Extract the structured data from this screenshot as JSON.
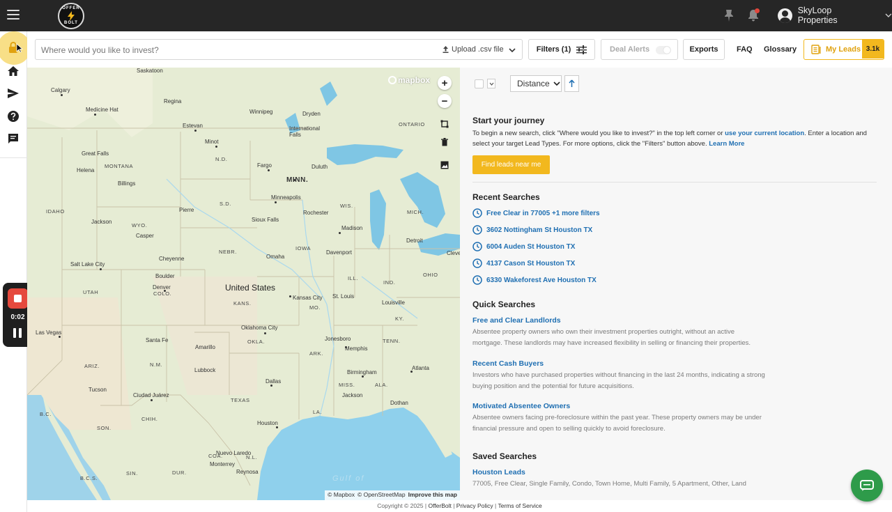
{
  "header": {
    "logo_text_top": "OFFER",
    "logo_text_bottom": "BOLT",
    "account_name": "SkyLoop Properties"
  },
  "recorder": {
    "time": "0:02"
  },
  "search": {
    "placeholder": "Where would you like to invest?",
    "upload_label": "Upload .csv file"
  },
  "toolbar": {
    "filters_label": "Filters (1)",
    "deal_alerts_label": "Deal Alerts",
    "exports_label": "Exports",
    "faq_label": "FAQ",
    "glossary_label": "Glossary",
    "my_leads_label": "My Leads",
    "my_leads_count": "3.1k"
  },
  "map": {
    "brand": "mapbox",
    "country_label": "United States",
    "gulf_label": "Gulf of",
    "attribution": [
      "© Mapbox",
      "© OpenStreetMap",
      "Improve this map"
    ],
    "states": [
      "MONTANA",
      "N.D.",
      "MINN.",
      "S.D.",
      "WIS.",
      "IDAHO",
      "WYO.",
      "IOWA",
      "NEBR.",
      "ILL.",
      "IND.",
      "OHIO",
      "UTAH",
      "COLO.",
      "KANS.",
      "MO.",
      "KY.",
      "ARIZ.",
      "N.M.",
      "OKLA.",
      "ARK.",
      "TENN.",
      "MISS.",
      "ALA.",
      "TEXAS",
      "LA.",
      "ONTARIO",
      "SON.",
      "CHIH.",
      "COA.",
      "N.L.",
      "B.C.",
      "B.C.S.",
      "SIN.",
      "DUR.",
      "MICH."
    ],
    "cities": [
      "Saskatoon",
      "Calgary",
      "Regina",
      "Medicine Hat",
      "Winnipeg",
      "Estevan",
      "Dryden",
      "International Falls",
      "Great Falls",
      "Helena",
      "Minot",
      "Billings",
      "Fargo",
      "Duluth",
      "Pierre",
      "Minneapolis",
      "Rochester",
      "Jackson",
      "Casper",
      "Sioux Falls",
      "Madison",
      "Detroit",
      "Salt Lake City",
      "Cheyenne",
      "Omaha",
      "Davenport",
      "Boulder",
      "Denver",
      "Kansas City",
      "St. Louis",
      "Louisville",
      "Las Vegas",
      "Santa Fe",
      "Amarillo",
      "Oklahoma City",
      "Jonesboro",
      "Memphis",
      "Lubbock",
      "Birmingham",
      "Atlanta",
      "Tucson",
      "Ciudad Juárez",
      "Dallas",
      "Jackson",
      "Dothan",
      "Houston",
      "Nuevo Laredo",
      "Monterrey",
      "Reynosa",
      "Cleve"
    ]
  },
  "sort": {
    "selected": "Distance"
  },
  "panel": {
    "start_title": "Start your journey",
    "start_text_1": "To begin a new search, click \"Where would you like to invest?\" in the top left corner or ",
    "start_link_1": "use your current location",
    "start_text_2": ". Enter a location and select your target Lead Types. For more options, click the \"Filters\" button above. ",
    "start_link_2": "Learn More",
    "find_button": "Find leads near me",
    "recent_title": "Recent Searches",
    "recent": [
      "Free Clear in 77005 +1 more filters",
      "3602 Nottingham St Houston TX",
      "6004 Auden St Houston TX",
      "4137 Cason St Houston TX",
      "6330 Wakeforest Ave Houston TX"
    ],
    "quick_title": "Quick Searches",
    "quick": [
      {
        "title": "Free and Clear Landlords",
        "desc": "Absentee property owners who own their investment properties outright, without an active mortgage. These landlords may have increased flexibility in selling or financing their properties."
      },
      {
        "title": "Recent Cash Buyers",
        "desc": "Investors who have purchased properties without financing in the last 24 months, indicating a strong buying position and the potential for future acquisitions."
      },
      {
        "title": "Motivated Absentee Owners",
        "desc": "Absentee owners facing pre-foreclosure within the past year. These property owners may be under financial pressure and open to selling quickly to avoid foreclosure."
      }
    ],
    "saved_title": "Saved Searches",
    "saved": [
      {
        "title": "Houston Leads",
        "desc": "77005, Free Clear, Single Family, Condo, Town Home, Multi Family, 5 Apartment, Other, Land"
      }
    ]
  },
  "footer": {
    "copyright": "Copyright © 2025 | ",
    "brand": "OfferBolt",
    "privacy": "Privacy Policy",
    "terms": "Terms of Service"
  },
  "colors": {
    "accent": "#f2b81e",
    "link": "#1f6fb2",
    "topbar": "#262626",
    "chat": "#2e9b4a",
    "recorder": "#e5493d"
  }
}
